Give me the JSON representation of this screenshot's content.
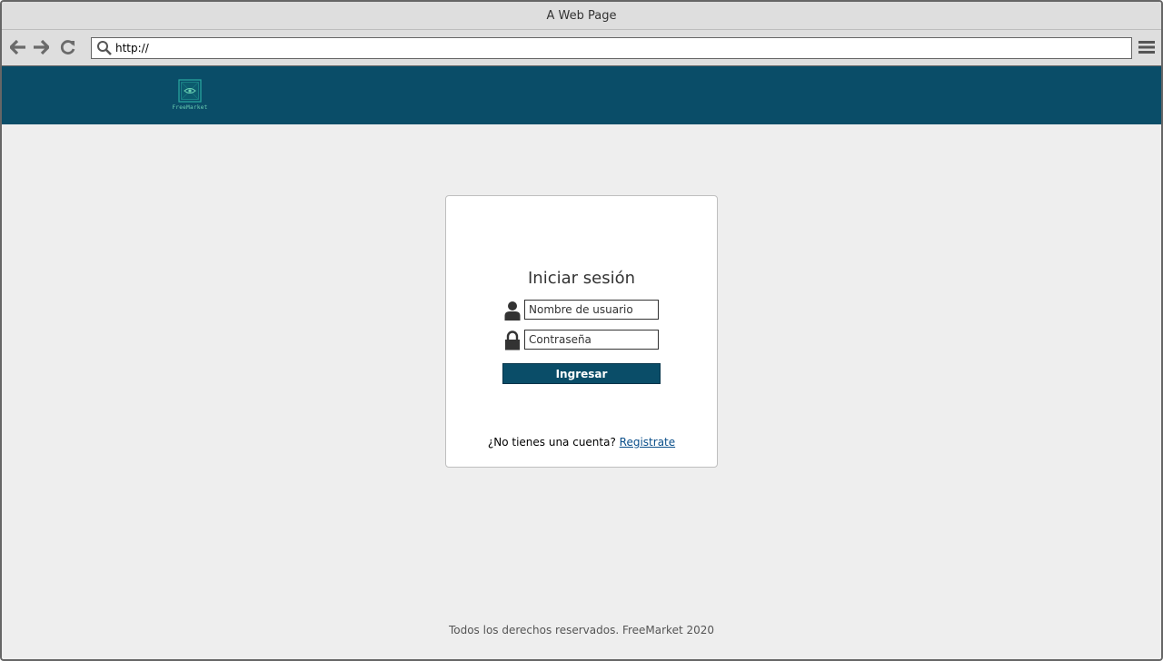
{
  "window": {
    "title": "A Web Page"
  },
  "browser": {
    "url": "http://",
    "icons": {
      "back": "arrow-left-icon",
      "forward": "arrow-right-icon",
      "reload": "reload-icon",
      "search": "search-icon",
      "menu": "hamburger-menu-icon"
    }
  },
  "header": {
    "logo_text": "FreeMarket",
    "background_color": "#0a4d68"
  },
  "login": {
    "title": "Iniciar sesión",
    "username_placeholder": "Nombre de usuario",
    "password_placeholder": "Contraseña",
    "submit_label": "Ingresar",
    "no_account_text": "¿No tienes una cuenta?",
    "register_link": "Registrate",
    "icons": {
      "username": "user-icon",
      "password": "lock-icon"
    }
  },
  "footer": {
    "text": "Todos los derechos reservados. FreeMarket 2020"
  },
  "colors": {
    "primary": "#0a4d68",
    "page_background": "#eeeeee",
    "link": "#0b4f8a",
    "logo_accent": "#6bd1b3"
  }
}
